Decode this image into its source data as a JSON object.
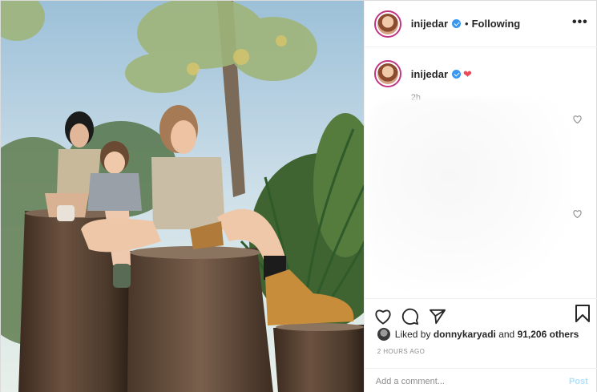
{
  "post": {
    "username": "inijedar",
    "separator": "•",
    "follow_status": "Following",
    "more": "•••",
    "caption": {
      "username": "inijedar",
      "emoji": "❤",
      "time": "2h"
    },
    "likes": {
      "prefix": "Liked by",
      "user": "donnykaryadi",
      "middle": "and",
      "count": "91,206 others"
    },
    "timestamp": "2 HOURS AGO",
    "comment_placeholder": "Add a comment...",
    "post_button": "Post",
    "icons": {
      "like": "heart-outline-icon",
      "comment": "comment-bubble-icon",
      "share": "paper-plane-icon",
      "save": "bookmark-icon",
      "comment_like": "small-heart-icon"
    },
    "colors": {
      "verified": "#3897f0",
      "heart": "#ed4956",
      "post_button": "#b2dffc",
      "muted": "#8e8e8e"
    }
  }
}
